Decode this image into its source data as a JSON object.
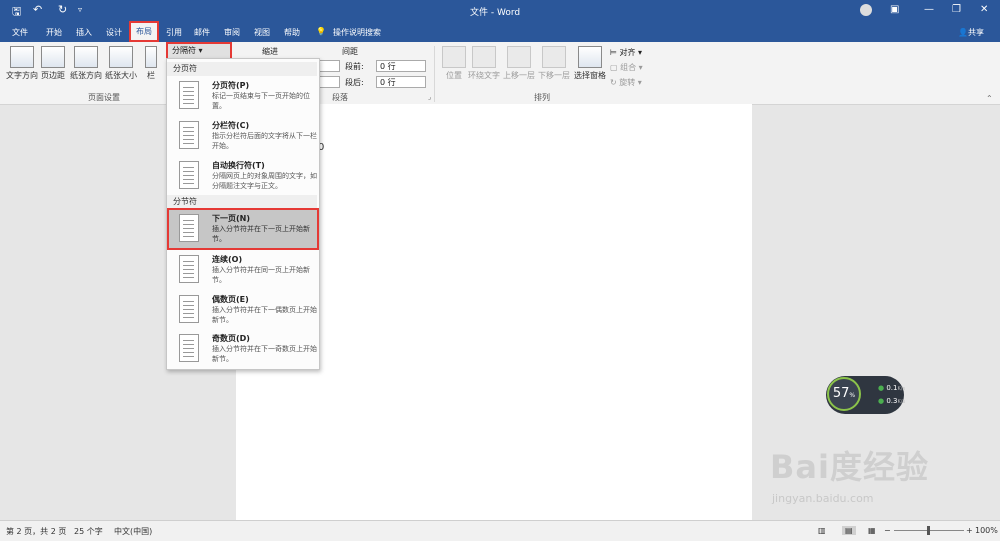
{
  "window": {
    "title": "文件 - Word",
    "share_label": "共享"
  },
  "quick_access": {
    "save_icon": "save-icon",
    "undo_icon": "undo-icon",
    "redo_icon": "redo-icon",
    "customize_icon": "customize-icon"
  },
  "tabs": [
    "文件",
    "开始",
    "插入",
    "设计",
    "布局",
    "引用",
    "邮件",
    "审阅",
    "视图",
    "帮助",
    "操作说明搜索"
  ],
  "ribbon": {
    "page_setup": {
      "buttons": [
        "文字方向",
        "页边距",
        "纸张方向",
        "纸张大小",
        "栏"
      ],
      "group_label": "页面设置",
      "breaks_button": "分隔符"
    },
    "indent": {
      "label": "缩进"
    },
    "spacing": {
      "label": "间距",
      "before_label": "段前:",
      "before_value": "0 行",
      "after_label": "段后:",
      "after_value": "0 行"
    },
    "paragraph": {
      "group_label": "段落"
    },
    "arrange": {
      "buttons": [
        "位置",
        "环绕文字",
        "上移一层",
        "下移一层",
        "选择窗格"
      ],
      "side": [
        "对齐",
        "组合",
        "旋转"
      ],
      "group_label": "排列"
    }
  },
  "breaks_menu": {
    "section1": "分页符",
    "section2": "分节符",
    "items": [
      {
        "title": "分页符(P)",
        "desc": "标记一页结束与下一页开始的位置。"
      },
      {
        "title": "分栏符(C)",
        "desc": "指示分栏符后面的文字将从下一栏开始。"
      },
      {
        "title": "自动换行符(T)",
        "desc": "分隔网页上的对象周围的文字，如分隔题注文字与正文。"
      },
      {
        "title": "下一页(N)",
        "desc": "插入分节符并在下一页上开始新节。"
      },
      {
        "title": "连续(O)",
        "desc": "插入分节符并在同一页上开始新节。"
      },
      {
        "title": "偶数页(E)",
        "desc": "插入分节符并在下一偶数页上开始新节。"
      },
      {
        "title": "奇数页(D)",
        "desc": "插入分节符并在下一奇数页上开始新节。"
      }
    ]
  },
  "document": {
    "visible_char": "0"
  },
  "speed_widget": {
    "percent": "57",
    "pct_sign": "%",
    "up": "0.1",
    "down": "0.3",
    "unit": "K/s"
  },
  "status": {
    "page": "第 2 页，共 2 页",
    "words": "25 个字",
    "lang": "中文(中国)",
    "zoom": "100%"
  },
  "watermark": {
    "brand": "Bai度经验",
    "url": "jingyan.baidu.com"
  }
}
